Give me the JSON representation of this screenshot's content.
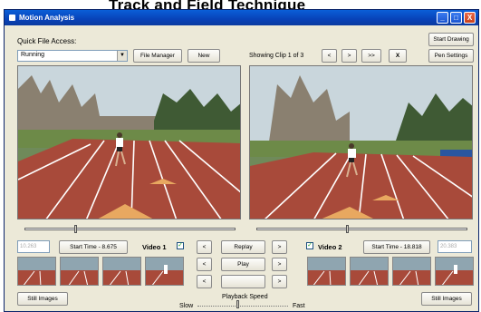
{
  "page_heading": "Track and Field Technique",
  "window": {
    "title": "Motion Analysis",
    "controls": [
      "_",
      "□",
      "X"
    ]
  },
  "quick_file": {
    "label": "Quick File Access:",
    "selected": "Running"
  },
  "buttons": {
    "file_manager": "File Manager",
    "new": "New",
    "start_drawing": "Start Drawing",
    "pen_settings": "Pen Settings",
    "prev_clip": "<",
    "next_clip": ">",
    "fast_forward": ">>",
    "clear": "X",
    "replay": "Replay",
    "play": "Play",
    "step_back_1": "<",
    "step_back_2": "<",
    "step_back_3": "<",
    "step_fwd_1": ">",
    "step_fwd_2": ">",
    "step_fwd_3": ">",
    "still_images_left": "Still Images",
    "still_images_right": "Still Images"
  },
  "clip_status": "Showing Clip 1 of 3",
  "video1": {
    "label": "Video 1",
    "start_time": "Start Time - 8.675",
    "time_box": "10.263",
    "checked": true
  },
  "video2": {
    "label": "Video 2",
    "start_time": "Start Time - 18.818",
    "time_box": "20.383",
    "checked": true
  },
  "playback": {
    "label": "Playback Speed",
    "slow": "Slow",
    "fast": "Fast",
    "level": 0.45
  },
  "scrub": {
    "video1_position": 0.24,
    "video2_position": 0.43
  },
  "colors": {
    "track": "#a84a3a",
    "lane_line": "#ffffff",
    "grass": "#6d8a48",
    "sky": "#c9d6dc",
    "marker": "#e8a860",
    "titlebar": "#0a4fc8"
  }
}
